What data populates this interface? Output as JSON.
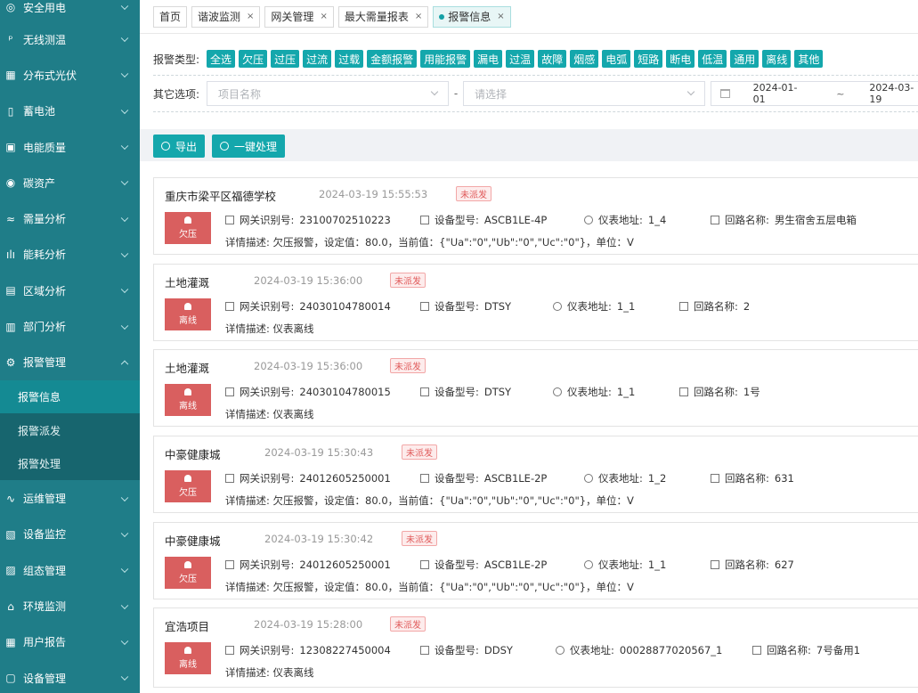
{
  "sidebar": {
    "items": [
      {
        "label": "安全用电",
        "icon": "shield-icon"
      },
      {
        "label": "无线测温",
        "icon": "thermometer-icon"
      },
      {
        "label": "分布式光伏",
        "icon": "solar-icon"
      },
      {
        "label": "蓄电池",
        "icon": "battery-icon"
      },
      {
        "label": "电能质量",
        "icon": "meter-icon"
      },
      {
        "label": "碳资产",
        "icon": "carbon-icon"
      },
      {
        "label": "需量分析",
        "icon": "trend-icon"
      },
      {
        "label": "能耗分析",
        "icon": "bar-chart-icon"
      },
      {
        "label": "区域分析",
        "icon": "region-icon"
      },
      {
        "label": "部门分析",
        "icon": "department-icon"
      },
      {
        "label": "报警管理",
        "icon": "gear-icon"
      }
    ],
    "sub_items": [
      {
        "label": "报警信息"
      },
      {
        "label": "报警派发"
      },
      {
        "label": "报警处理"
      }
    ],
    "items_after": [
      {
        "label": "运维管理",
        "icon": "wave-icon"
      },
      {
        "label": "设备监控",
        "icon": "monitor-icon"
      },
      {
        "label": "组态管理",
        "icon": "config-icon"
      },
      {
        "label": "环境监测",
        "icon": "home-icon"
      },
      {
        "label": "用户报告",
        "icon": "report-icon"
      },
      {
        "label": "设备管理",
        "icon": "device-icon"
      }
    ]
  },
  "tabs": [
    {
      "label": "首页",
      "closable": false
    },
    {
      "label": "谐波监测",
      "closable": true
    },
    {
      "label": "网关管理",
      "closable": true
    },
    {
      "label": "最大需量报表",
      "closable": true
    },
    {
      "label": "报警信息",
      "closable": true,
      "active": true
    }
  ],
  "filter": {
    "type_label": "报警类型:",
    "types": [
      "全选",
      "欠压",
      "过压",
      "过流",
      "过载",
      "金额报警",
      "用能报警",
      "漏电",
      "过温",
      "故障",
      "烟感",
      "电弧",
      "短路",
      "断电",
      "低温",
      "通用",
      "离线",
      "其他"
    ],
    "other_label": "其它选项:",
    "project_placeholder": "项目名称",
    "dash": "-",
    "select_placeholder": "请选择",
    "date_start": "2024-01-01",
    "date_sep": "~",
    "date_end": "2024-03-19"
  },
  "toolbar": {
    "export_label": "导出",
    "process_label": "一键处理"
  },
  "labels": {
    "gateway": "网关识别号:",
    "device": "设备型号:",
    "meter": "仪表地址:",
    "circuit": "回路名称:",
    "detail": "详情描述:"
  },
  "alarms": [
    {
      "title": "重庆市梁平区福德学校",
      "time": "2024-03-19 15:55:53",
      "status": "未派发",
      "type": "欠压",
      "gateway": "23100702510223",
      "device": "ASCB1LE-4P",
      "meter": "1_4",
      "circuit": "男生宿舍五层电箱",
      "detail": "欠压报警，设定值：80.0，当前值：{\"Ua\":\"0\",\"Ub\":\"0\",\"Uc\":\"0\"}，单位：V"
    },
    {
      "title": "土地灌溉",
      "time": "2024-03-19 15:36:00",
      "status": "未派发",
      "type": "离线",
      "gateway": "24030104780014",
      "device": "DTSY",
      "meter": "1_1",
      "circuit": "2",
      "detail": "仪表离线"
    },
    {
      "title": "土地灌溉",
      "time": "2024-03-19 15:36:00",
      "status": "未派发",
      "type": "离线",
      "gateway": "24030104780015",
      "device": "DTSY",
      "meter": "1_1",
      "circuit": "1号",
      "detail": "仪表离线"
    },
    {
      "title": "中豪健康城",
      "time": "2024-03-19 15:30:43",
      "status": "未派发",
      "type": "欠压",
      "gateway": "24012605250001",
      "device": "ASCB1LE-2P",
      "meter": "1_2",
      "circuit": "631",
      "detail": "欠压报警，设定值：80.0，当前值：{\"Ua\":\"0\",\"Ub\":\"0\",\"Uc\":\"0\"}，单位：V"
    },
    {
      "title": "中豪健康城",
      "time": "2024-03-19 15:30:42",
      "status": "未派发",
      "type": "欠压",
      "gateway": "24012605250001",
      "device": "ASCB1LE-2P",
      "meter": "1_1",
      "circuit": "627",
      "detail": "欠压报警，设定值：80.0，当前值：{\"Ua\":\"0\",\"Ub\":\"0\",\"Uc\":\"0\"}，单位：V"
    },
    {
      "title": "宜浩项目",
      "time": "2024-03-19 15:28:00",
      "status": "未派发",
      "type": "离线",
      "gateway": "12308227450004",
      "device": "DDSY",
      "meter": "00028877020567_1",
      "circuit": "7号备用1",
      "detail": "仪表离线"
    }
  ]
}
